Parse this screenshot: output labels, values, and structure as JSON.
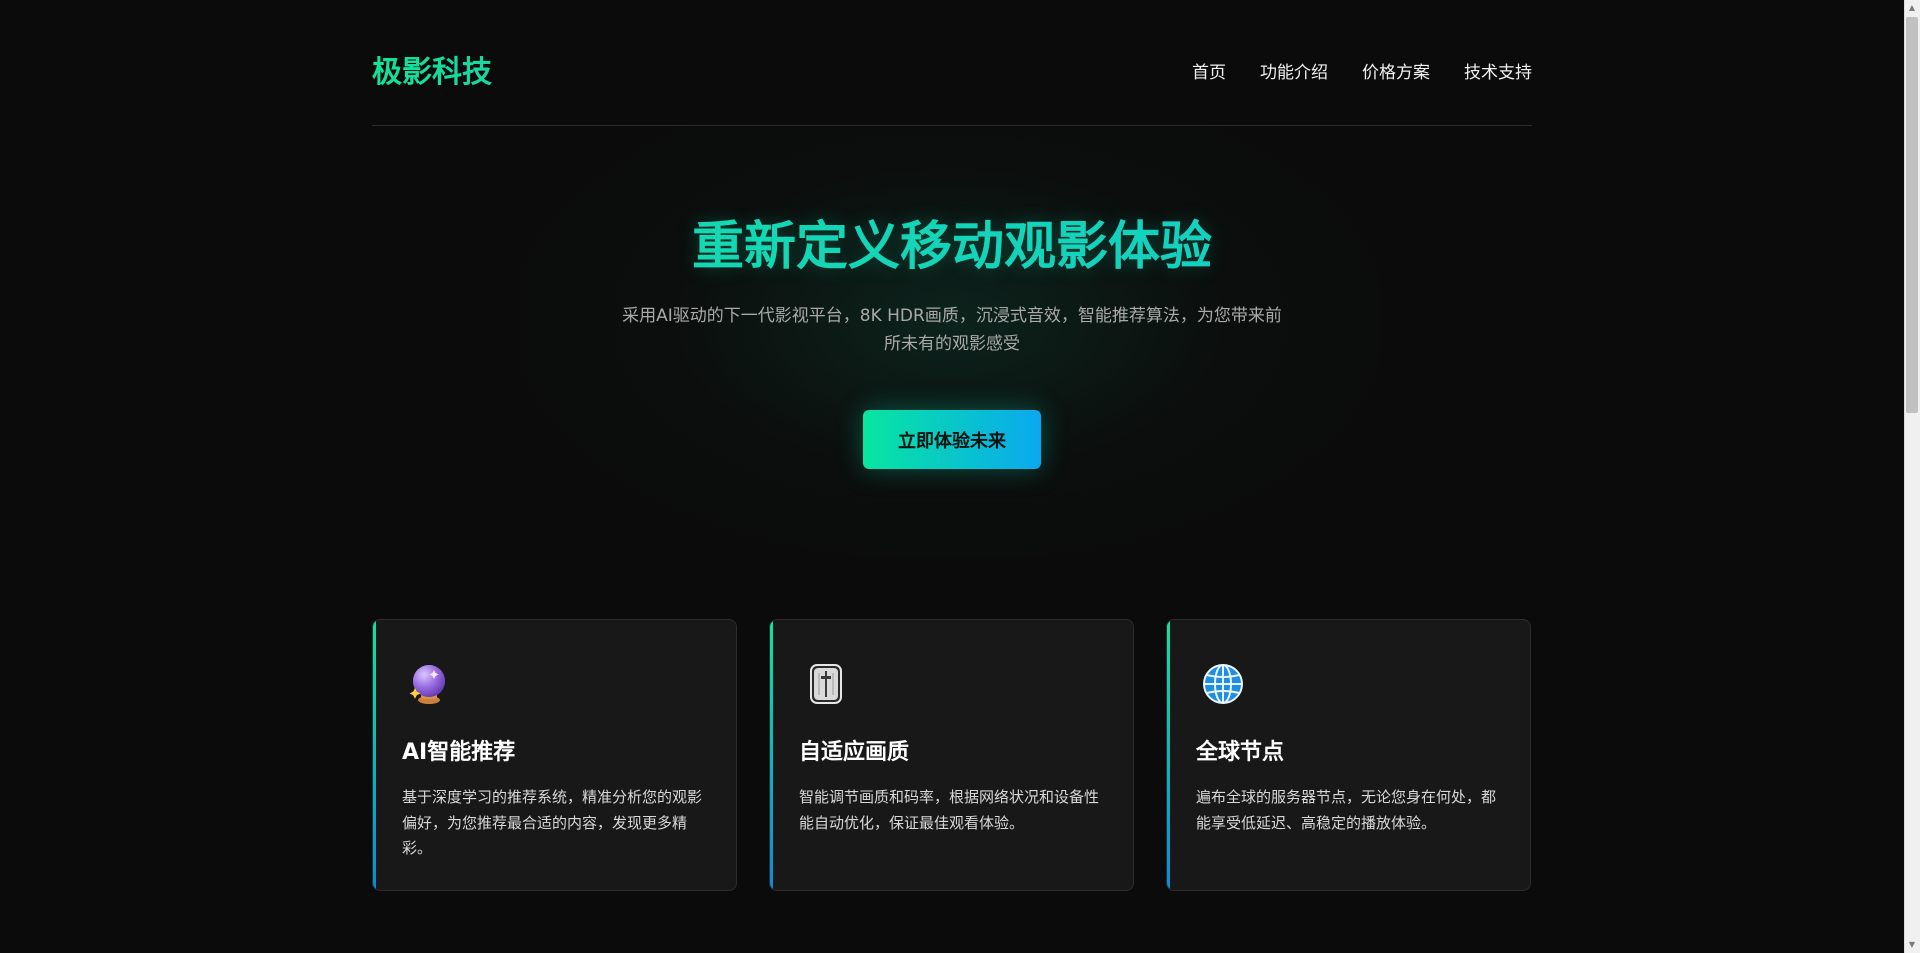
{
  "header": {
    "logo": "极影科技",
    "nav": [
      "首页",
      "功能介绍",
      "价格方案",
      "技术支持"
    ]
  },
  "hero": {
    "title": "重新定义移动观影体验",
    "subtitle_line1": "采用AI驱动的下一代影视平台，8K HDR画质，沉浸式音效，智能推荐算法，为您带来前",
    "subtitle_line2": "所未有的观影感受",
    "cta": "立即体验未来"
  },
  "features": [
    {
      "icon": "crystal-ball-icon",
      "title": "AI智能推荐",
      "desc": "基于深度学习的推荐系统，精准分析您的观影偏好，为您推荐最合适的内容，发现更多精彩。"
    },
    {
      "icon": "control-knobs-icon",
      "title": "自适应画质",
      "desc": "智能调节画质和码率，根据网络状况和设备性能自动优化，保证最佳观看体验。"
    },
    {
      "icon": "globe-icon",
      "title": "全球节点",
      "desc": "遍布全球的服务器节点，无论您身在何处，都能享受低延迟、高稳定的播放体验。"
    }
  ],
  "colors": {
    "accent_start": "#12e39a",
    "accent_end": "#0aa8f0",
    "background": "#0b0b0b",
    "card_bg": "#181818"
  }
}
